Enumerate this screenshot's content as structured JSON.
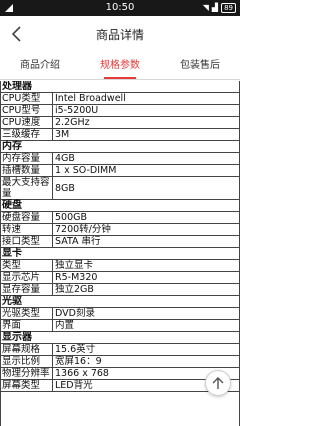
{
  "status": {
    "time": "10:50",
    "battery": "89"
  },
  "header": {
    "title": "商品详情"
  },
  "tabs": [
    {
      "label": "商品介绍"
    },
    {
      "label": "规格参数"
    },
    {
      "label": "包装售后"
    }
  ],
  "colors": {
    "accent": "#e53b3b",
    "statusbar": "#181818"
  },
  "specs": {
    "processor": {
      "title": "处理器",
      "rows": [
        {
          "k": "CPU类型",
          "v": "Intel Broadwell"
        },
        {
          "k": "CPU型号",
          "v": "i5-5200U"
        },
        {
          "k": "CPU速度",
          "v": "2.2GHz"
        },
        {
          "k": "三级缓存",
          "v": "3M"
        }
      ]
    },
    "memory": {
      "title": "内存",
      "rows": [
        {
          "k": "内存容量",
          "v": "4GB"
        },
        {
          "k": "插槽数量",
          "v": "1 x SO-DIMM"
        },
        {
          "k": "最大支持容量",
          "v": "8GB"
        }
      ]
    },
    "disk": {
      "title": "硬盘",
      "rows": [
        {
          "k": "硬盘容量",
          "v": "500GB"
        },
        {
          "k": "转速",
          "v": "7200转/分钟"
        },
        {
          "k": "接口类型",
          "v": "SATA 串行"
        }
      ]
    },
    "gpu": {
      "title": "显卡",
      "rows": [
        {
          "k": "类型",
          "v": "独立显卡"
        },
        {
          "k": "显示芯片",
          "v": "R5-M320"
        },
        {
          "k": "显存容量",
          "v": "独立2GB"
        }
      ]
    },
    "optical": {
      "title": "光驱",
      "rows": [
        {
          "k": "光驱类型",
          "v": "DVD刻录"
        },
        {
          "k": "界面",
          "v": "内置"
        }
      ]
    },
    "display": {
      "title": "显示器",
      "rows": [
        {
          "k": "屏幕规格",
          "v": "15.6英寸"
        },
        {
          "k": "显示比例",
          "v": "宽屏16：9"
        },
        {
          "k": "物理分辨率",
          "v": "1366 x 768"
        },
        {
          "k": "屏幕类型",
          "v": "LED背光"
        }
      ]
    }
  }
}
